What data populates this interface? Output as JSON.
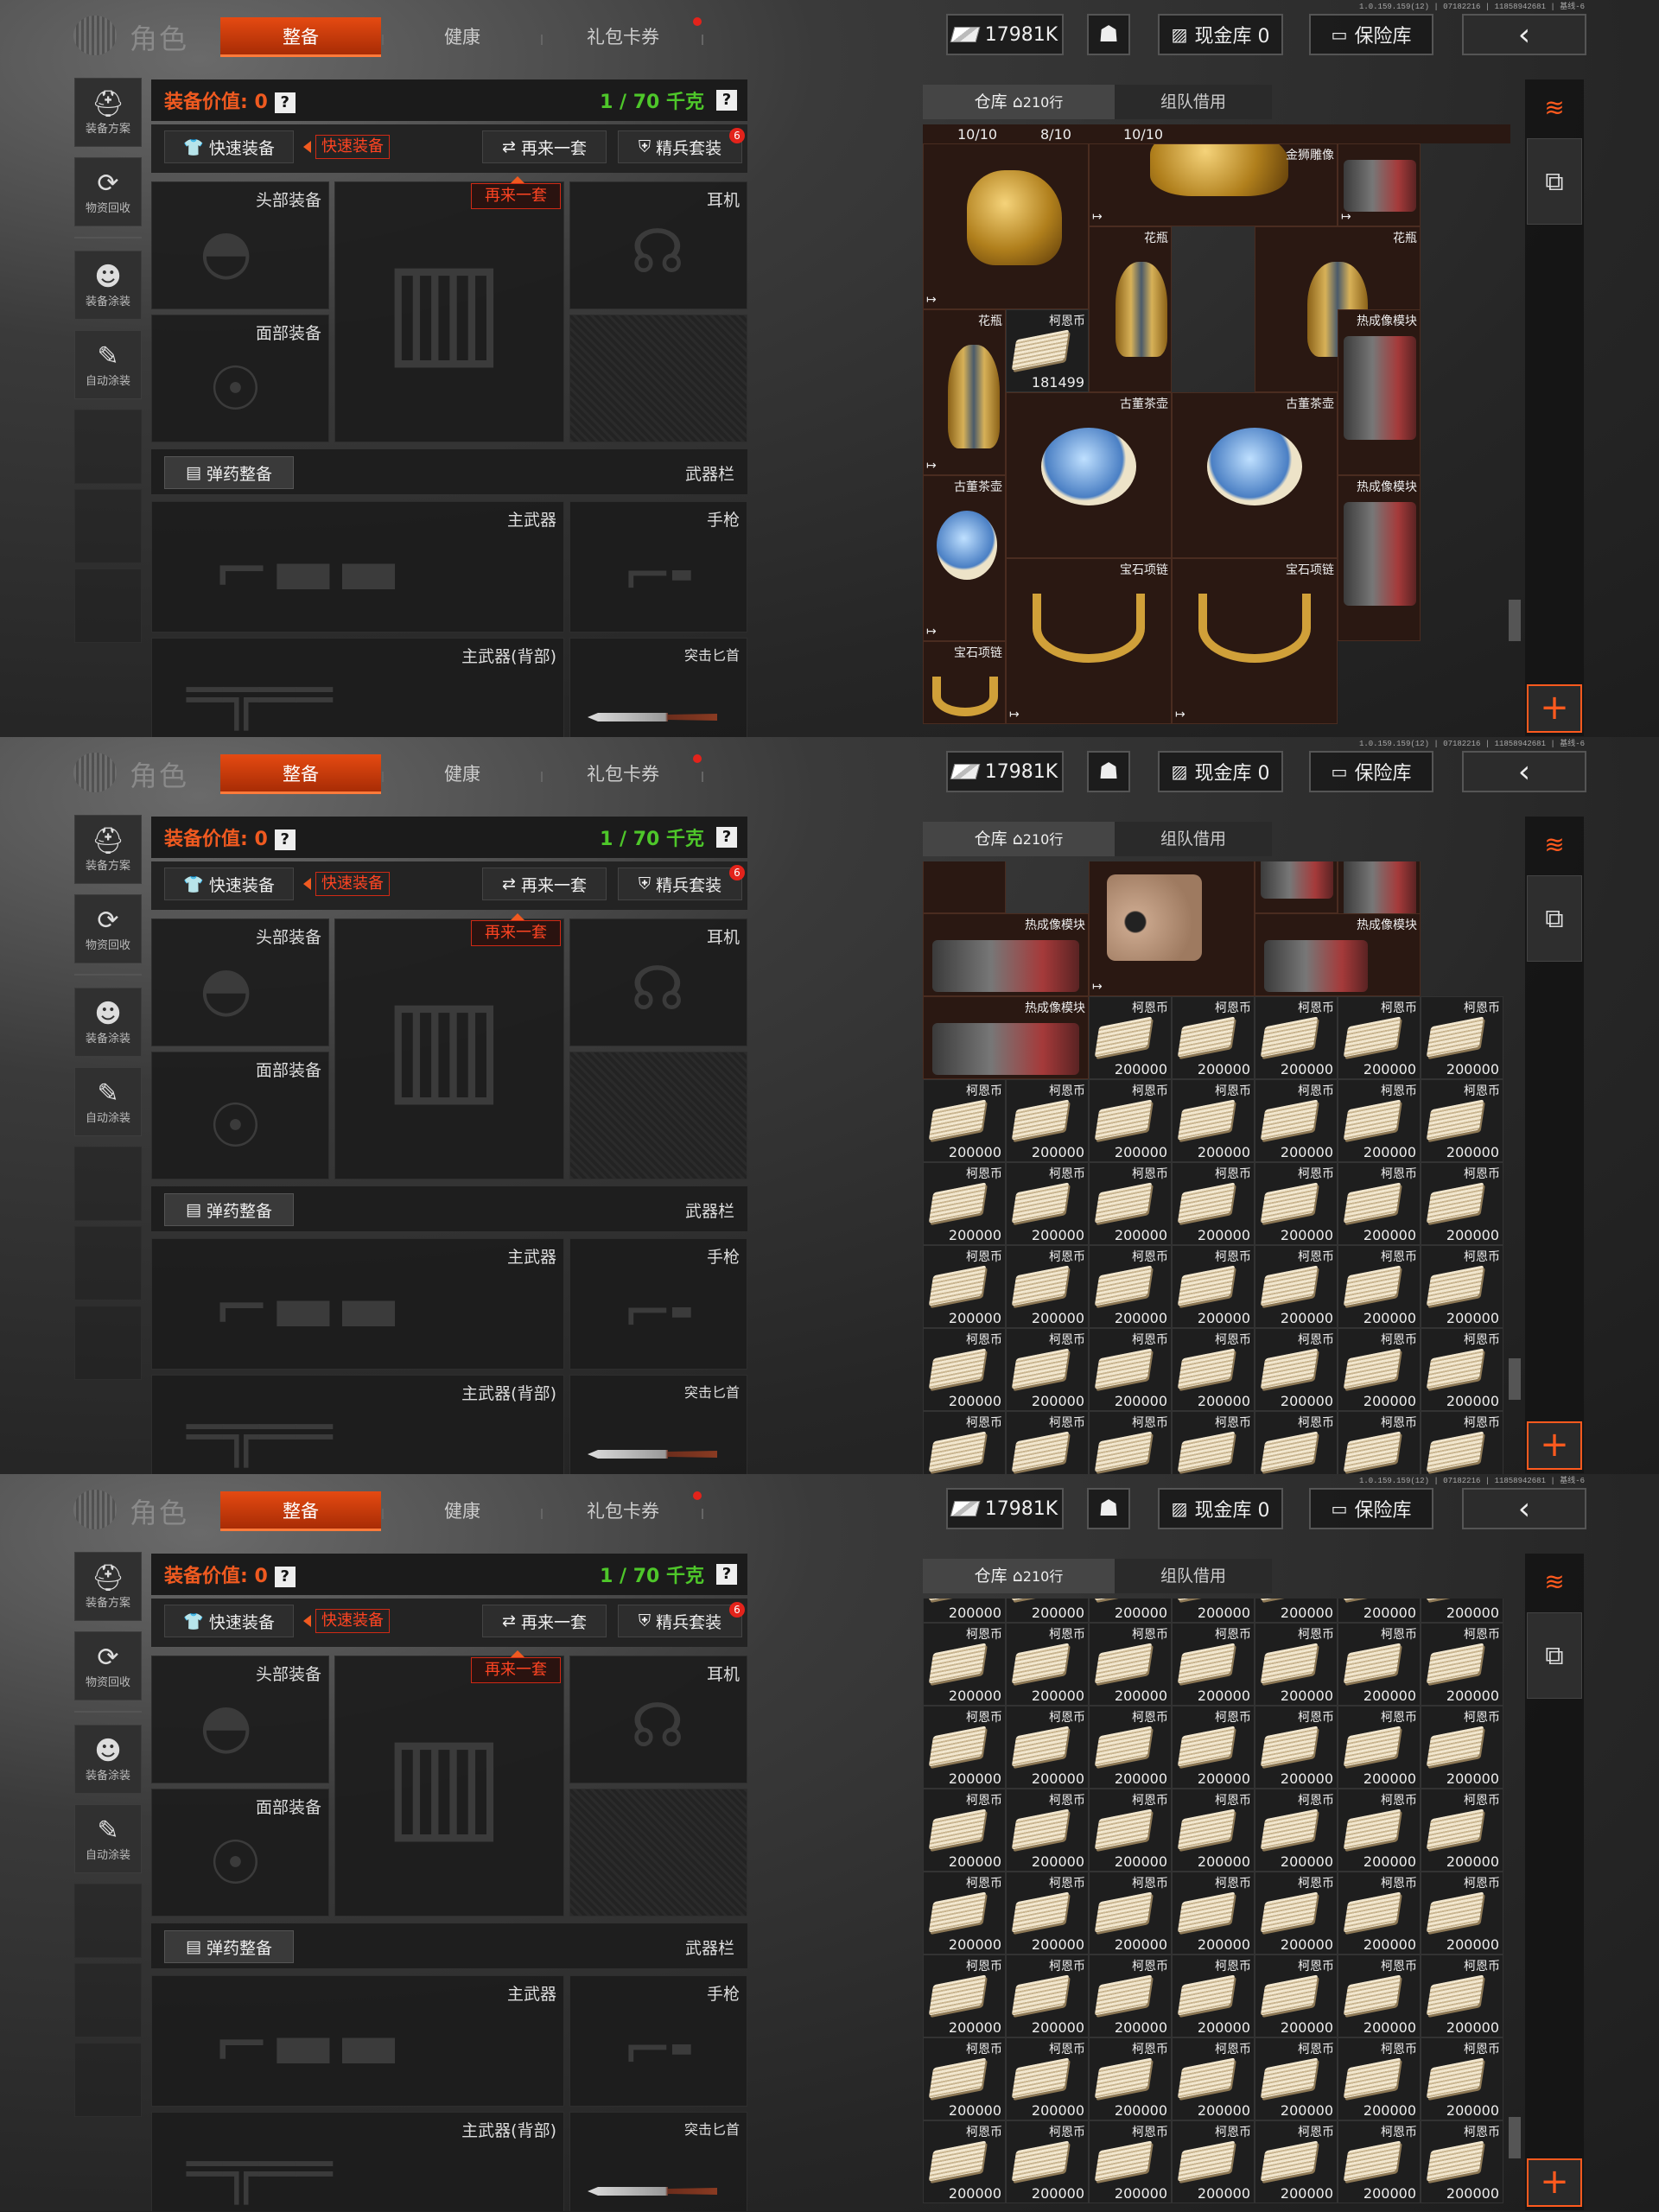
{
  "version": "1.0.159.159(12) | 07182216 | 11858942681 | 基线-6",
  "header": {
    "title": "角色",
    "tabs": [
      "整备",
      "健康",
      "礼包卡券"
    ],
    "currency": "17981K",
    "cash_vault": "现金库 0",
    "insurance": "保险库"
  },
  "sidebar": {
    "items": [
      "装备方案",
      "物资回收",
      "装备涂装",
      "自动涂装"
    ]
  },
  "equipment": {
    "value_label": "装备价值: 0",
    "weight": "1 / 70 千克",
    "quick_equip": "快速装备",
    "quick_equip_tag": "快速装备",
    "again": "再来一套",
    "again_tip": "再来一套",
    "elite": "精兵套装",
    "elite_badge": "6",
    "slots": {
      "head": "头部装备",
      "ear": "耳机",
      "face": "面部装备",
      "ammo": "弹药整备",
      "weapon_bar": "武器栏",
      "primary": "主武器",
      "pistol": "手枪",
      "primary_back": "主武器(背部)",
      "melee": "突击匕首"
    }
  },
  "stash": {
    "tab_warehouse": "仓库",
    "rows": "210行",
    "tab_team": "组队借用",
    "coin_name": "柯恩币",
    "coin_value": "200000"
  },
  "view1": {
    "top_counts": [
      "10/10",
      "8/10",
      "10/10"
    ],
    "items": [
      {
        "name": "金狮雕像"
      },
      {
        "name": "花瓶"
      },
      {
        "name": "花瓶"
      },
      {
        "name": "花瓶"
      },
      {
        "name": "柯恩币",
        "value": "181499"
      },
      {
        "name": "古董茶壶"
      },
      {
        "name": "古董茶壶"
      },
      {
        "name": "古董茶壶"
      },
      {
        "name": "热成像模块"
      },
      {
        "name": "宝石项链"
      },
      {
        "name": "宝石项链"
      },
      {
        "name": "宝石项链"
      },
      {
        "name": "热成像模块"
      }
    ]
  },
  "view2": {
    "items": [
      {
        "name": "热成像模块"
      },
      {
        "name": "热成像模块"
      },
      {
        "name": "热成像模块"
      }
    ]
  }
}
